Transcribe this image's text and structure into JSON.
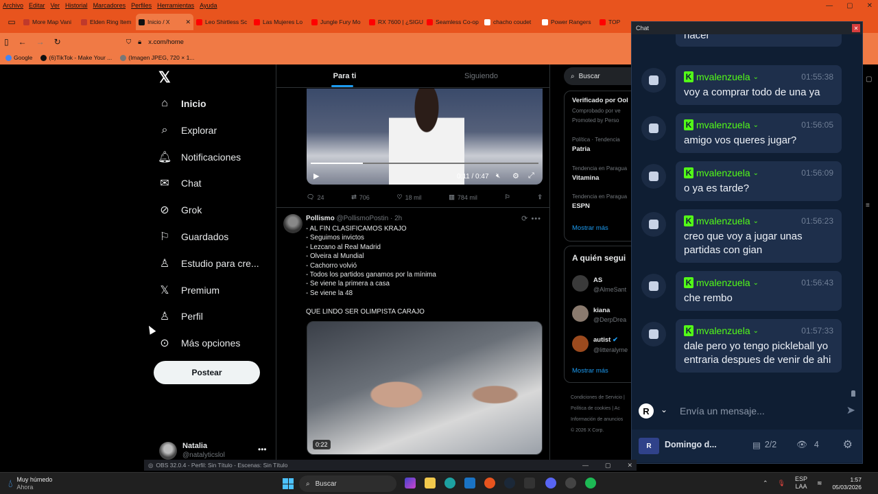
{
  "menubar": {
    "items": [
      "Archivo",
      "Editar",
      "Ver",
      "Historial",
      "Marcadores",
      "Perfiles",
      "Herramientas",
      "Ayuda"
    ]
  },
  "tabs": [
    {
      "label": "More Map Vani",
      "color": "#c0392b"
    },
    {
      "label": "Elden Ring Item",
      "color": "#c0392b"
    },
    {
      "label": "Inicio / X",
      "color": "#111111",
      "active": true
    },
    {
      "label": "Leo Shirtless Sc",
      "color": "#ff0000"
    },
    {
      "label": "Las Mujeres Lo",
      "color": "#ff0000"
    },
    {
      "label": "Jungle Fury Mo",
      "color": "#ff0000"
    },
    {
      "label": "RX 7600 | ¿SIGU",
      "color": "#ff0000"
    },
    {
      "label": "Seamless Co-op",
      "color": "#ff0000"
    },
    {
      "label": "chacho coudet",
      "color": "#ffffff"
    },
    {
      "label": "Power Rangers",
      "color": "#ffffff"
    },
    {
      "label": "TOP",
      "color": "#ff0000"
    }
  ],
  "address": {
    "url": "x.com/home"
  },
  "bookmarks": [
    {
      "label": "Google",
      "color": "#4285f4"
    },
    {
      "label": "(6)TikTok - Make Your ...",
      "color": "#111111"
    },
    {
      "label": "(Imagen JPEG, 720 × 1...",
      "color": "#777777"
    }
  ],
  "xnav": {
    "items": [
      {
        "label": "Inicio",
        "icon": "home-icon"
      },
      {
        "label": "Explorar",
        "icon": "search-icon"
      },
      {
        "label": "Notificaciones",
        "icon": "bell-icon"
      },
      {
        "label": "Chat",
        "icon": "mail-icon"
      },
      {
        "label": "Grok",
        "icon": "grok-icon"
      },
      {
        "label": "Guardados",
        "icon": "bookmark-icon"
      },
      {
        "label": "Estudio para cre...",
        "icon": "studio-icon"
      },
      {
        "label": "Premium",
        "icon": "x-icon"
      },
      {
        "label": "Perfil",
        "icon": "person-icon"
      },
      {
        "label": "Más opciones",
        "icon": "more-icon"
      }
    ],
    "post_label": "Postear",
    "profile_name": "Natalia",
    "profile_handle": "@natalyticslol"
  },
  "timeline": {
    "tabs": [
      "Para ti",
      "Siguiendo"
    ],
    "tweet1": {
      "video_time": "0:11 / 0:47",
      "progress": 0.23,
      "replies": "24",
      "reposts": "706",
      "likes": "18 mil",
      "views": "784 mil"
    },
    "tweet2": {
      "name": "Pollismo",
      "handle": "@PollismoPostin · 2h",
      "lines": [
        "- AL FIN CLASIFICAMOS KRAJO",
        "- Seguimos invictos",
        "- Lezcano al Real Madrid",
        "- Olveira al Mundial",
        "- Cachorro volvió",
        "- Todos los partidos ganamos por la mínima",
        "- Se viene la primera a casa",
        "- Se viene la 48",
        "",
        "QUE LINDO SER OLIMPISTA CARAJO"
      ],
      "video_badge": "0:22"
    }
  },
  "rightcol": {
    "search_placeholder": "Buscar",
    "verified_title": "Verificado por Ool",
    "verified_sub": "Comprobado por ve",
    "promoted": "Promoted by Perso",
    "trends": [
      {
        "context": "Política · Tendencia",
        "name": "Patria"
      },
      {
        "context": "Tendencia en Paragua",
        "name": "Vitamina"
      },
      {
        "context": "Tendencia en Paragua",
        "name": "ESPN"
      }
    ],
    "show_more": "Mostrar más",
    "who_title": "A quién segui",
    "who": [
      {
        "name": "AS",
        "handle": "@AlmeSant"
      },
      {
        "name": "kiana",
        "handle": "@DerpDrea"
      },
      {
        "name": "autist",
        "handle": "@litteralyme"
      }
    ],
    "who_more": "Mostrar más",
    "footer": [
      "Condiciones de Servicio |",
      "Política de cookies | Ac",
      "Información de anuncios",
      "© 2026 X Corp."
    ]
  },
  "chat": {
    "window_title": "Chat",
    "top_partial": "hacer",
    "messages": [
      {
        "user": "mvalenzuela",
        "time": "01:55:38",
        "text": "voy a comprar todo de una ya"
      },
      {
        "user": "mvalenzuela",
        "time": "01:56:05",
        "text": "amigo vos queres jugar?"
      },
      {
        "user": "mvalenzuela",
        "time": "01:56:09",
        "text": "o ya es tarde?"
      },
      {
        "user": "mvalenzuela",
        "time": "01:56:23",
        "text": "creo que voy a jugar unas partidas con gian"
      },
      {
        "user": "mvalenzuela",
        "time": "01:56:43",
        "text": "che rembo"
      },
      {
        "user": "mvalenzuela",
        "time": "01:57:33",
        "text": "dale pero yo tengo pickleball yo entraria despues de venir de ahi"
      }
    ],
    "input_placeholder": "Envía un mensaje...",
    "channel_badge": "R",
    "footer_name": "Domingo d...",
    "footer_slots": "2/2",
    "footer_viewers": "4"
  },
  "obs": {
    "title": "OBS 32.0.4 - Perfil: Sin Título - Escenas: Sin Título"
  },
  "taskbar": {
    "weather": "Muy húmedo",
    "weather_sub": "Ahora",
    "search": "Buscar",
    "lang": "ESP",
    "lang_sub": "LAA",
    "time": "1:57",
    "date": "05/03/2026"
  }
}
